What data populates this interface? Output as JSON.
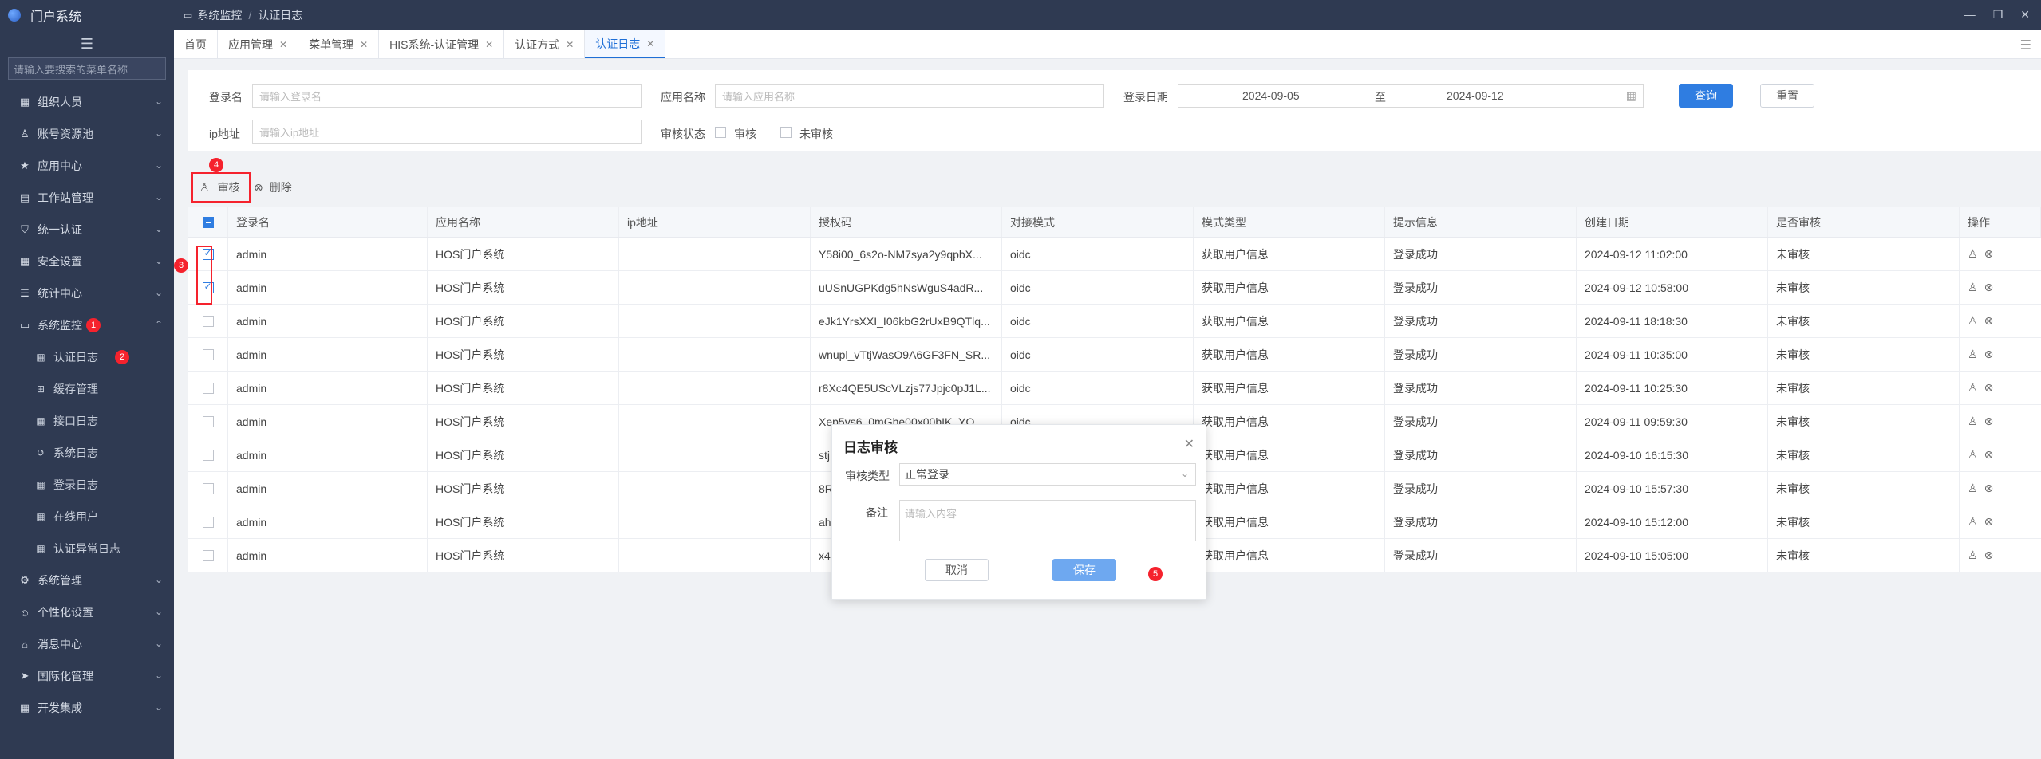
{
  "app": {
    "title": "门户系统"
  },
  "sidebar": {
    "search_placeholder": "请输入要搜索的菜单名称",
    "items": [
      {
        "label": "组织人员",
        "icon": "grid-icon"
      },
      {
        "label": "账号资源池",
        "icon": "user-icon"
      },
      {
        "label": "应用中心",
        "icon": "star-icon"
      },
      {
        "label": "工作站管理",
        "icon": "server-icon"
      },
      {
        "label": "统一认证",
        "icon": "shield-icon"
      },
      {
        "label": "安全设置",
        "icon": "grid-icon"
      },
      {
        "label": "统计中心",
        "icon": "list-icon"
      },
      {
        "label": "系统监控",
        "icon": "monitor-icon"
      }
    ],
    "sub_items": [
      {
        "label": "认证日志",
        "icon": "grid-icon"
      },
      {
        "label": "缓存管理",
        "icon": "basket-icon"
      },
      {
        "label": "接口日志",
        "icon": "grid-icon"
      },
      {
        "label": "系统日志",
        "icon": "history-icon"
      },
      {
        "label": "登录日志",
        "icon": "grid-icon"
      },
      {
        "label": "在线用户",
        "icon": "grid-icon"
      },
      {
        "label": "认证异常日志",
        "icon": "grid-icon"
      }
    ],
    "bottom_items": [
      {
        "label": "系统管理",
        "icon": "gear-icon"
      },
      {
        "label": "个性化设置",
        "icon": "people-icon"
      },
      {
        "label": "消息中心",
        "icon": "home-icon"
      },
      {
        "label": "国际化管理",
        "icon": "send-icon"
      },
      {
        "label": "开发集成",
        "icon": "grid-icon"
      }
    ]
  },
  "breadcrumb": {
    "parent": "系统监控",
    "sep": "/",
    "current": "认证日志"
  },
  "tabs": [
    "首页",
    "应用管理",
    "菜单管理",
    "HIS系统-认证管理",
    "认证方式",
    "认证日志"
  ],
  "filter": {
    "login_label": "登录名",
    "login_placeholder": "请输入登录名",
    "app_label": "应用名称",
    "app_placeholder": "请输入应用名称",
    "date_label": "登录日期",
    "date_start": "2024-09-05",
    "date_sep": "至",
    "date_end": "2024-09-12",
    "query_btn": "查询",
    "reset_btn": "重置",
    "ip_label": "ip地址",
    "ip_placeholder": "请输入ip地址",
    "status_label": "审核状态",
    "opt_reviewed": "审核",
    "opt_unreviewed": "未审核"
  },
  "toolbar": {
    "review": "审核",
    "delete": "删除"
  },
  "annotations": [
    "1",
    "2",
    "3",
    "4",
    "5"
  ],
  "table": {
    "headers": [
      "登录名",
      "应用名称",
      "ip地址",
      "授权码",
      "对接模式",
      "模式类型",
      "提示信息",
      "创建日期",
      "是否审核",
      "操作"
    ],
    "rows": [
      {
        "login": "admin",
        "app": "HOS门户系统",
        "ip": "",
        "code": "Y58i00_6s2o-NM7sya2y9qpbX...",
        "mode": "oidc",
        "type": "获取用户信息",
        "msg": "登录成功",
        "date": "2024-09-12 11:02:00",
        "status": "未审核",
        "checked": true
      },
      {
        "login": "admin",
        "app": "HOS门户系统",
        "ip": "",
        "code": "uUSnUGPKdg5hNsWguS4adR...",
        "mode": "oidc",
        "type": "获取用户信息",
        "msg": "登录成功",
        "date": "2024-09-12 10:58:00",
        "status": "未审核",
        "checked": true
      },
      {
        "login": "admin",
        "app": "HOS门户系统",
        "ip": "",
        "code": "eJk1YrsXXI_I06kbG2rUxB9QTlq...",
        "mode": "oidc",
        "type": "获取用户信息",
        "msg": "登录成功",
        "date": "2024-09-11 18:18:30",
        "status": "未审核",
        "checked": false
      },
      {
        "login": "admin",
        "app": "HOS门户系统",
        "ip": "",
        "code": "wnupl_vTtjWasO9A6GF3FN_SR...",
        "mode": "oidc",
        "type": "获取用户信息",
        "msg": "登录成功",
        "date": "2024-09-11 10:35:00",
        "status": "未审核",
        "checked": false
      },
      {
        "login": "admin",
        "app": "HOS门户系统",
        "ip": "",
        "code": "r8Xc4QE5UScVLzjs77Jpjc0pJ1L...",
        "mode": "oidc",
        "type": "获取用户信息",
        "msg": "登录成功",
        "date": "2024-09-11 10:25:30",
        "status": "未审核",
        "checked": false
      },
      {
        "login": "admin",
        "app": "HOS门户系统",
        "ip": "",
        "code": "Xep5vs6_0mGhe00x00bIK_YQ...",
        "mode": "oidc",
        "type": "获取用户信息",
        "msg": "登录成功",
        "date": "2024-09-11 09:59:30",
        "status": "未审核",
        "checked": false
      },
      {
        "login": "admin",
        "app": "HOS门户系统",
        "ip": "",
        "code": "stj",
        "mode": "",
        "type": "获取用户信息",
        "msg": "登录成功",
        "date": "2024-09-10 16:15:30",
        "status": "未审核",
        "checked": false
      },
      {
        "login": "admin",
        "app": "HOS门户系统",
        "ip": "",
        "code": "8R",
        "mode": "",
        "type": "获取用户信息",
        "msg": "登录成功",
        "date": "2024-09-10 15:57:30",
        "status": "未审核",
        "checked": false
      },
      {
        "login": "admin",
        "app": "HOS门户系统",
        "ip": "",
        "code": "ah",
        "mode": "",
        "type": "获取用户信息",
        "msg": "登录成功",
        "date": "2024-09-10 15:12:00",
        "status": "未审核",
        "checked": false
      },
      {
        "login": "admin",
        "app": "HOS门户系统",
        "ip": "",
        "code": "x4",
        "mode": "",
        "type": "获取用户信息",
        "msg": "登录成功",
        "date": "2024-09-10 15:05:00",
        "status": "未审核",
        "checked": false
      }
    ]
  },
  "dialog": {
    "title": "日志审核",
    "type_label": "审核类型",
    "type_value": "正常登录",
    "note_label": "备注",
    "note_placeholder": "请输入内容",
    "cancel": "取消",
    "save": "保存"
  },
  "colors": {
    "sidebar": "#2f3a52",
    "accent": "#2f7de1",
    "annotation": "#f5222d"
  }
}
